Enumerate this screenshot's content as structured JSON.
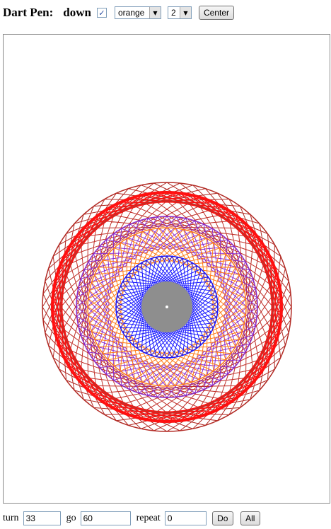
{
  "toolbar": {
    "title": "Dart Pen:",
    "pen_state": "down",
    "pen_down_checked": true,
    "color_select_value": "orange",
    "width_select_value": "2",
    "center_label": "Center"
  },
  "bottom": {
    "turn_label": "turn",
    "turn_value": "33",
    "go_label": "go",
    "go_value": "60",
    "repeat_label": "repeat",
    "repeat_value": "0",
    "do_label": "Do",
    "all_label": "All"
  },
  "drawing": {
    "hub_color": "#8e8e8e",
    "dart_color": "#ffffff",
    "rings": [
      {
        "name": "brown",
        "color": "#b22a24"
      },
      {
        "name": "red",
        "color": "#ff1010"
      },
      {
        "name": "brown",
        "color": "#c0302a"
      },
      {
        "name": "purple",
        "color": "#8a2acb"
      },
      {
        "name": "orange",
        "color": "#ff7a14"
      },
      {
        "name": "blue",
        "color": "#1a1aff"
      }
    ]
  }
}
